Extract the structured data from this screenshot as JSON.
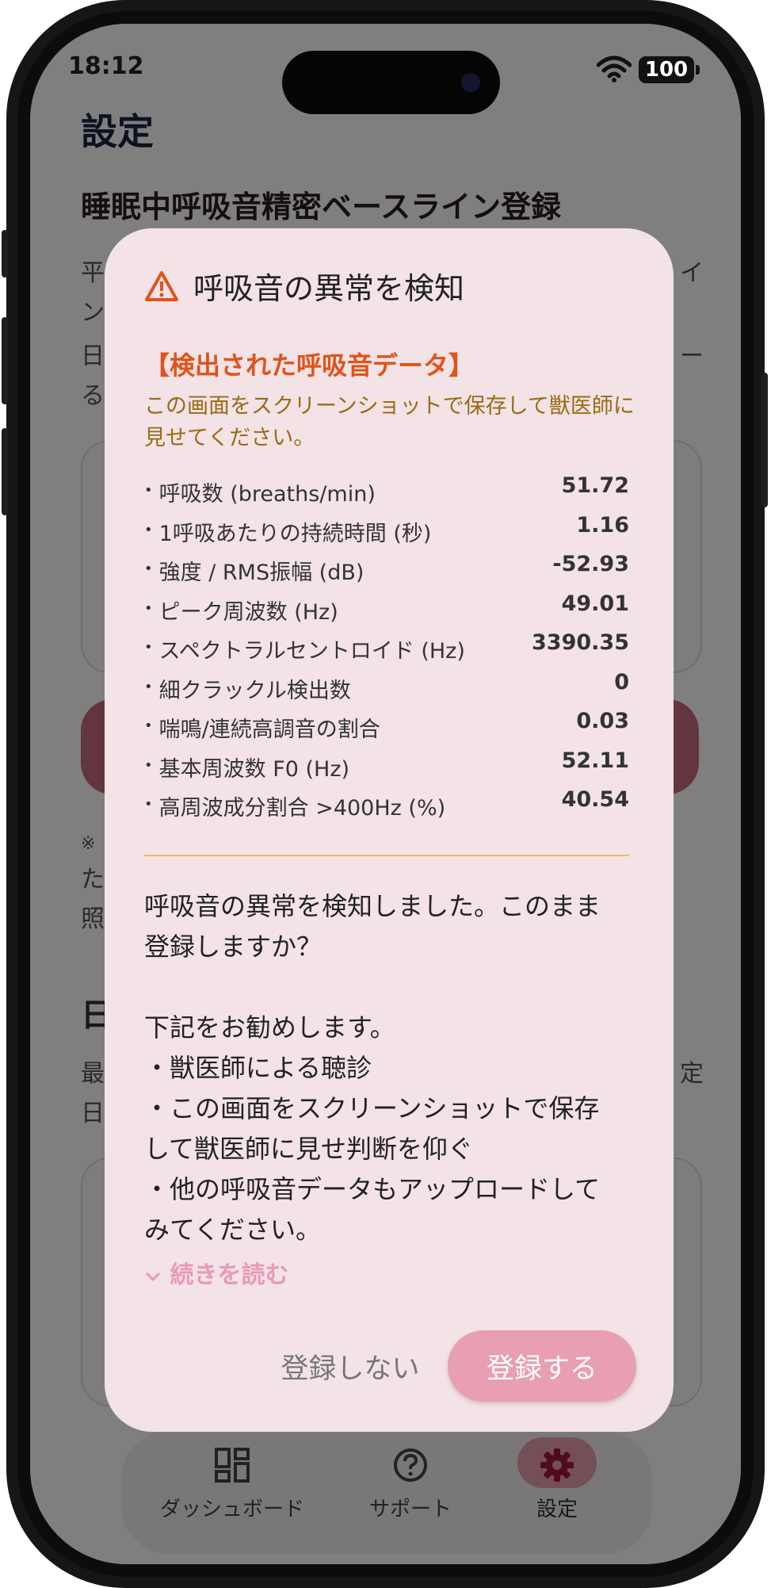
{
  "status_bar": {
    "time": "18:12",
    "battery": "100"
  },
  "page": {
    "title": "設定",
    "section_title": "睡眠中呼吸音精密ベースライン登録",
    "bg_line_1_start": "平",
    "bg_line_1_end": "イ",
    "bg_line_2_start": "ン",
    "bg_line_3_start": "日",
    "bg_line_3_end": "ー",
    "bg_line_4_start": "る",
    "bg_note_1": "※",
    "bg_note_2_start": "た",
    "bg_note_3_start": "照",
    "bg_heading_2": "日",
    "bg_line_5_start": "最",
    "bg_line_5_end": "定",
    "bg_line_6_start": "日"
  },
  "tabbar": {
    "items": [
      {
        "label": "ダッシュボード",
        "icon": "dashboard-icon"
      },
      {
        "label": "サポート",
        "icon": "help-circle-icon"
      },
      {
        "label": "設定",
        "icon": "gear-icon"
      }
    ]
  },
  "dialog": {
    "title": "呼吸音の異常を検知",
    "detected_heading": "【検出された呼吸音データ】",
    "instruction": "この画面をスクリーンショットで保存して獣医師に見せてください。",
    "metrics": [
      {
        "label": "呼吸数 (breaths/min)",
        "value": "51.72"
      },
      {
        "label": "1呼吸あたりの持続時間 (秒)",
        "value": "1.16"
      },
      {
        "label": "強度 / RMS振幅 (dB)",
        "value": "-52.93"
      },
      {
        "label": "ピーク周波数 (Hz)",
        "value": "49.01"
      },
      {
        "label": "スペクトラルセントロイド (Hz)",
        "value": "3390.35"
      },
      {
        "label": "細クラックル検出数",
        "value": "0"
      },
      {
        "label": "喘鳴/連続高調音の割合",
        "value": "0.03"
      },
      {
        "label": "基本周波数 F0 (Hz)",
        "value": "52.11"
      },
      {
        "label": "高周波成分割合 >400Hz (%)",
        "value": "40.54"
      }
    ],
    "message_lines": [
      "呼吸音の異常を検知しました。このまま",
      "登録しますか？",
      "",
      "下記をお勧めします。",
      "・獣医師による聴診",
      "・この画面をスクリーンショットで保存",
      "して獣医師に見せ判断を仰ぐ",
      "・他の呼吸音データもアップロードして",
      "みてください。"
    ],
    "read_more": "続きを読む",
    "cancel_label": "登録しない",
    "confirm_label": "登録する"
  },
  "colors": {
    "accent_pink": "#e89fb1",
    "warning_orange": "#e0531a",
    "divider_gold": "#f0b95a"
  }
}
